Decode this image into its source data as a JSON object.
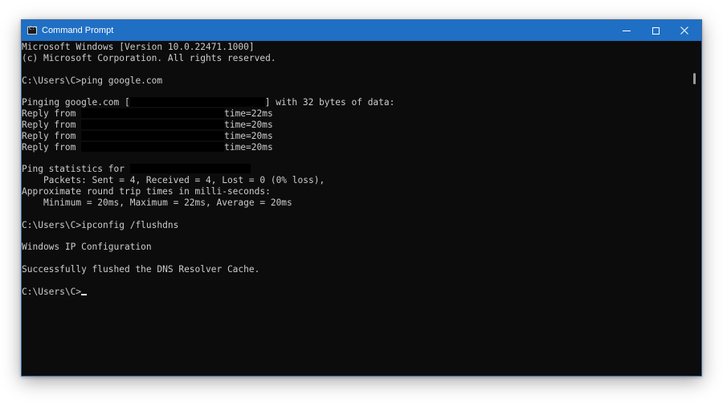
{
  "window": {
    "title": "Command Prompt",
    "icon": "cmd-icon",
    "controls": {
      "minimize_icon": "minimize-icon",
      "maximize_icon": "maximize-icon",
      "close_icon": "close-icon"
    },
    "titlebar_color": "#1f6fc4",
    "console_bg": "#0c0c0c",
    "console_fg": "#cccccc"
  },
  "console": {
    "header_line1": "Microsoft Windows [Version 10.0.22471.1000]",
    "header_line2": "(c) Microsoft Corporation. All rights reserved.",
    "prompt1": "C:\\Users\\C>",
    "command1": "ping google.com",
    "pinging_prefix": "Pinging google.com [",
    "pinging_suffix": "] with 32 bytes of data:",
    "replies": [
      {
        "prefix": "Reply from ",
        "time": "time=22ms"
      },
      {
        "prefix": "Reply from ",
        "time": "time=20ms"
      },
      {
        "prefix": "Reply from ",
        "time": "time=20ms"
      },
      {
        "prefix": "Reply from ",
        "time": "time=20ms"
      }
    ],
    "stats_prefix": "Ping statistics for ",
    "packets_line": "    Packets: Sent = 4, Received = 4, Lost = 0 (0% loss),",
    "rtt_header": "Approximate round trip times in milli-seconds:",
    "rtt_line": "    Minimum = 20ms, Maximum = 22ms, Average = 20ms",
    "prompt2": "C:\\Users\\C>",
    "command2": "ipconfig /flushdns",
    "ipconfig_header": "Windows IP Configuration",
    "flush_result": "Successfully flushed the DNS Resolver Cache.",
    "prompt3": "C:\\Users\\C>"
  }
}
